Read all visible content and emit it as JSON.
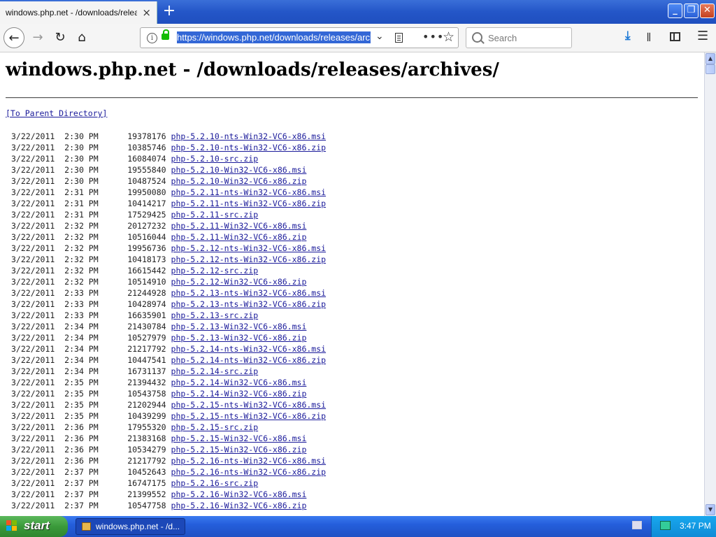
{
  "browser": {
    "tab_title": "windows.php.net - /downloads/releases/archives/",
    "tab_close": "×",
    "new_tab": "+",
    "url": "https://windows.php.net/downloads/releases/archives/",
    "search_placeholder": "Search",
    "window_controls": {
      "minimize": "_",
      "maximize": "❐",
      "close": "✕"
    },
    "icons": {
      "back": "←",
      "forward": "→",
      "reload": "↻",
      "home": "⌂",
      "url_dropdown": "⌄",
      "page_actions": "•••",
      "bookmark": "☆",
      "downloads": "⤓",
      "library": "𝍪",
      "menu": "☰"
    }
  },
  "page": {
    "title": "windows.php.net - /downloads/releases/archives/",
    "parent_link": "[To Parent Directory]",
    "listing": [
      {
        "date": "3/22/2011",
        "time": "2:30 PM",
        "size": "19378176",
        "name": "php-5.2.10-nts-Win32-VC6-x86.msi"
      },
      {
        "date": "3/22/2011",
        "time": "2:30 PM",
        "size": "10385746",
        "name": "php-5.2.10-nts-Win32-VC6-x86.zip"
      },
      {
        "date": "3/22/2011",
        "time": "2:30 PM",
        "size": "16084074",
        "name": "php-5.2.10-src.zip"
      },
      {
        "date": "3/22/2011",
        "time": "2:30 PM",
        "size": "19555840",
        "name": "php-5.2.10-Win32-VC6-x86.msi"
      },
      {
        "date": "3/22/2011",
        "time": "2:30 PM",
        "size": "10487524",
        "name": "php-5.2.10-Win32-VC6-x86.zip"
      },
      {
        "date": "3/22/2011",
        "time": "2:31 PM",
        "size": "19950080",
        "name": "php-5.2.11-nts-Win32-VC6-x86.msi"
      },
      {
        "date": "3/22/2011",
        "time": "2:31 PM",
        "size": "10414217",
        "name": "php-5.2.11-nts-Win32-VC6-x86.zip"
      },
      {
        "date": "3/22/2011",
        "time": "2:31 PM",
        "size": "17529425",
        "name": "php-5.2.11-src.zip"
      },
      {
        "date": "3/22/2011",
        "time": "2:32 PM",
        "size": "20127232",
        "name": "php-5.2.11-Win32-VC6-x86.msi"
      },
      {
        "date": "3/22/2011",
        "time": "2:32 PM",
        "size": "10516044",
        "name": "php-5.2.11-Win32-VC6-x86.zip"
      },
      {
        "date": "3/22/2011",
        "time": "2:32 PM",
        "size": "19956736",
        "name": "php-5.2.12-nts-Win32-VC6-x86.msi"
      },
      {
        "date": "3/22/2011",
        "time": "2:32 PM",
        "size": "10418173",
        "name": "php-5.2.12-nts-Win32-VC6-x86.zip"
      },
      {
        "date": "3/22/2011",
        "time": "2:32 PM",
        "size": "16615442",
        "name": "php-5.2.12-src.zip"
      },
      {
        "date": "3/22/2011",
        "time": "2:32 PM",
        "size": "10514910",
        "name": "php-5.2.12-Win32-VC6-x86.zip"
      },
      {
        "date": "3/22/2011",
        "time": "2:33 PM",
        "size": "21244928",
        "name": "php-5.2.13-nts-Win32-VC6-x86.msi"
      },
      {
        "date": "3/22/2011",
        "time": "2:33 PM",
        "size": "10428974",
        "name": "php-5.2.13-nts-Win32-VC6-x86.zip"
      },
      {
        "date": "3/22/2011",
        "time": "2:33 PM",
        "size": "16635901",
        "name": "php-5.2.13-src.zip"
      },
      {
        "date": "3/22/2011",
        "time": "2:34 PM",
        "size": "21430784",
        "name": "php-5.2.13-Win32-VC6-x86.msi"
      },
      {
        "date": "3/22/2011",
        "time": "2:34 PM",
        "size": "10527979",
        "name": "php-5.2.13-Win32-VC6-x86.zip"
      },
      {
        "date": "3/22/2011",
        "time": "2:34 PM",
        "size": "21217792",
        "name": "php-5.2.14-nts-Win32-VC6-x86.msi"
      },
      {
        "date": "3/22/2011",
        "time": "2:34 PM",
        "size": "10447541",
        "name": "php-5.2.14-nts-Win32-VC6-x86.zip"
      },
      {
        "date": "3/22/2011",
        "time": "2:34 PM",
        "size": "16731137",
        "name": "php-5.2.14-src.zip"
      },
      {
        "date": "3/22/2011",
        "time": "2:35 PM",
        "size": "21394432",
        "name": "php-5.2.14-Win32-VC6-x86.msi"
      },
      {
        "date": "3/22/2011",
        "time": "2:35 PM",
        "size": "10543758",
        "name": "php-5.2.14-Win32-VC6-x86.zip"
      },
      {
        "date": "3/22/2011",
        "time": "2:35 PM",
        "size": "21202944",
        "name": "php-5.2.15-nts-Win32-VC6-x86.msi"
      },
      {
        "date": "3/22/2011",
        "time": "2:35 PM",
        "size": "10439299",
        "name": "php-5.2.15-nts-Win32-VC6-x86.zip"
      },
      {
        "date": "3/22/2011",
        "time": "2:36 PM",
        "size": "17955320",
        "name": "php-5.2.15-src.zip"
      },
      {
        "date": "3/22/2011",
        "time": "2:36 PM",
        "size": "21383168",
        "name": "php-5.2.15-Win32-VC6-x86.msi"
      },
      {
        "date": "3/22/2011",
        "time": "2:36 PM",
        "size": "10534279",
        "name": "php-5.2.15-Win32-VC6-x86.zip"
      },
      {
        "date": "3/22/2011",
        "time": "2:36 PM",
        "size": "21217792",
        "name": "php-5.2.16-nts-Win32-VC6-x86.msi"
      },
      {
        "date": "3/22/2011",
        "time": "2:37 PM",
        "size": "10452643",
        "name": "php-5.2.16-nts-Win32-VC6-x86.zip"
      },
      {
        "date": "3/22/2011",
        "time": "2:37 PM",
        "size": "16747175",
        "name": "php-5.2.16-src.zip"
      },
      {
        "date": "3/22/2011",
        "time": "2:37 PM",
        "size": "21399552",
        "name": "php-5.2.16-Win32-VC6-x86.msi"
      },
      {
        "date": "3/22/2011",
        "time": "2:37 PM",
        "size": "10547758",
        "name": "php-5.2.16-Win32-VC6-x86.zip"
      }
    ]
  },
  "taskbar": {
    "start_label": "start",
    "task_label": "windows.php.net - /d...",
    "clock": "3:47 PM"
  },
  "colors": {
    "link": "#1a1a9a",
    "url_selection": "#3367d6",
    "xp_blue": "#245edb",
    "start_green": "#3a9a3a",
    "lock_green": "#12bc00"
  }
}
